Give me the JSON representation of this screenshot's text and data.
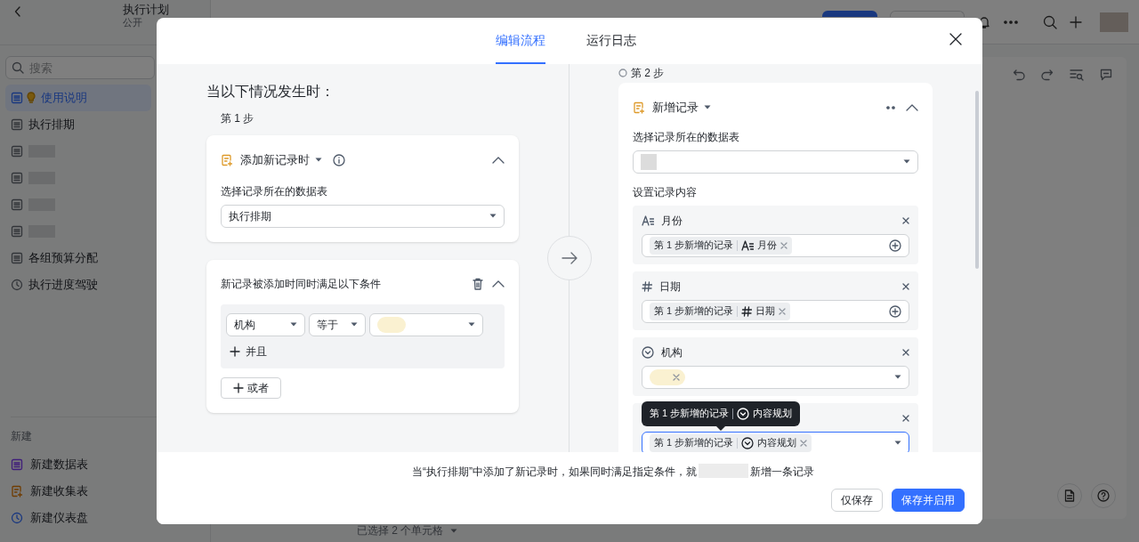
{
  "app": {
    "title": "执行计划",
    "visibility": "公开",
    "search": {
      "placeholder": "搜索"
    },
    "sidebar": {
      "items": [
        {
          "label": "使用说明",
          "kind": "guide",
          "selected": true
        },
        {
          "label": "执行排期",
          "kind": "table",
          "selected": false
        },
        {
          "kind": "table",
          "selected": false
        },
        {
          "kind": "table",
          "selected": false
        },
        {
          "kind": "table",
          "selected": false
        },
        {
          "kind": "table",
          "selected": false
        },
        {
          "label": "各组预算分配",
          "kind": "table",
          "selected": false
        },
        {
          "label": "执行进度驾驶",
          "kind": "dashboard",
          "selected": false
        }
      ]
    },
    "new_section": {
      "title": "新建",
      "items": [
        {
          "label": "新建数据表",
          "kind": "table"
        },
        {
          "label": "新建收集表",
          "kind": "form"
        },
        {
          "label": "新建仪表盘",
          "kind": "dashboard"
        }
      ]
    },
    "status_bar": "已选择 2 个单元格"
  },
  "dialog": {
    "tabs": [
      {
        "label": "编辑流程",
        "selected": true
      },
      {
        "label": "运行日志",
        "selected": false
      }
    ],
    "trigger": {
      "heading": "当以下情况发生时：",
      "step": "第 1 步",
      "event": "添加新记录时",
      "table_label": "选择记录所在的数据表",
      "table_value": "执行排期",
      "conditions_title": "新记录被添加时同时满足以下条件",
      "conditions": [
        {
          "field": "机构",
          "operator": "等于",
          "value": {
            "kind": "option"
          }
        }
      ],
      "and_button": "并且",
      "or_button": "或者"
    },
    "action": {
      "step": "第 2 步",
      "type": "新增记录",
      "table_label": "选择记录所在的数据表",
      "content_label": "设置记录内容",
      "fields": [
        {
          "label": "月份",
          "kind": "text",
          "focused": false,
          "value": {
            "kind": "token",
            "source": "第 1 步新增的记录",
            "field": {
              "label": "月份",
              "kind": "text"
            }
          }
        },
        {
          "label": "日期",
          "kind": "number",
          "focused": false,
          "value": {
            "kind": "token",
            "source": "第 1 步新增的记录",
            "field": {
              "label": "日期",
              "kind": "number"
            }
          }
        },
        {
          "label": "机构",
          "kind": "select",
          "focused": false,
          "value": {
            "kind": "option"
          }
        },
        {
          "kind": "select",
          "focused": true,
          "value": {
            "kind": "token",
            "source": "第 1 步新增的记录",
            "field": {
              "label": "内容规划",
              "kind": "select"
            }
          }
        }
      ],
      "tooltip": {
        "source": "第 1 步新增的记录",
        "field": {
          "label": "内容规划",
          "kind": "select"
        }
      }
    },
    "summary": [
      "当“执行排期”中添加了新记录时，如果同时满足指定条件，就",
      "新增一条记录"
    ],
    "buttons": [
      {
        "label": "仅保存",
        "kind": "secondary"
      },
      {
        "label": "保存并启用",
        "kind": "primary"
      }
    ]
  }
}
